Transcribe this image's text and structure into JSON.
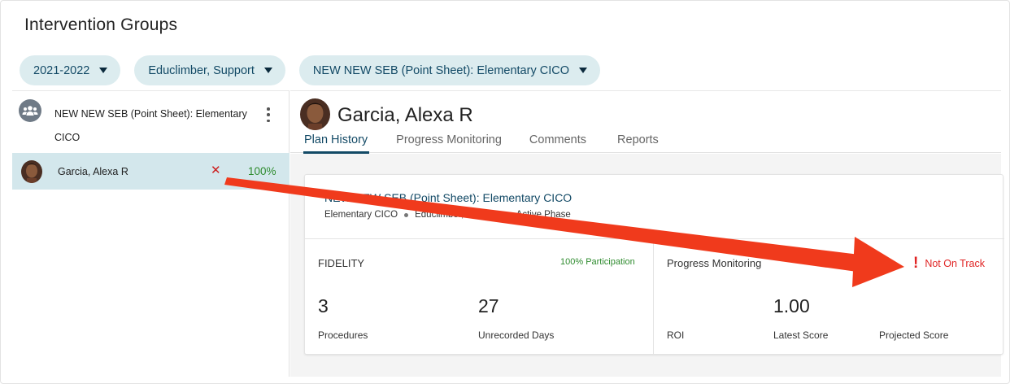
{
  "page": {
    "title": "Intervention Groups"
  },
  "filters": [
    {
      "label": "2021-2022"
    },
    {
      "label": "Educlimber, Support"
    },
    {
      "label": "NEW NEW SEB (Point Sheet): Elementary CICO"
    }
  ],
  "sidebar": {
    "group": {
      "name": "NEW NEW SEB (Point Sheet): Elementary CICO",
      "icon": "group-icon"
    },
    "students": [
      {
        "name": "Garcia, Alexa R",
        "status_icon": "close-icon",
        "percent": "100%"
      }
    ]
  },
  "student": {
    "name": "Garcia, Alexa R",
    "tabs": [
      {
        "label": "Plan History",
        "active": true
      },
      {
        "label": "Progress Monitoring",
        "active": false
      },
      {
        "label": "Comments",
        "active": false
      },
      {
        "label": "Reports",
        "active": false
      }
    ]
  },
  "plan": {
    "title": "NEW NEW SEB (Point Sheet): Elementary CICO",
    "meta": [
      "Elementary CICO",
      "Educlimber, Support",
      "Active Phase"
    ],
    "fidelity": {
      "heading": "FIDELITY",
      "participation": "100% Participation",
      "procedures_value": "3",
      "procedures_label": "Procedures",
      "unrecorded_value": "27",
      "unrecorded_label": "Unrecorded Days"
    },
    "progress": {
      "heading": "Progress Monitoring",
      "status": "Not On Track",
      "status_icon": "exclamation-icon",
      "roi_label": "ROI",
      "latest_value": "1.00",
      "latest_label": "Latest Score",
      "projected_label": "Projected Score"
    }
  },
  "colors": {
    "accent": "#134a66",
    "pill_bg": "#dcecef",
    "selected_row": "#d3e7ec",
    "success": "#2e8b2e",
    "danger": "#e02424",
    "annotation_arrow": "#f03a1c"
  }
}
